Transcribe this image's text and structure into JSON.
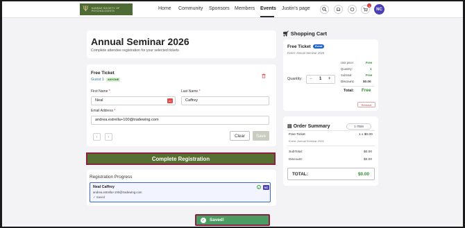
{
  "nav": {
    "logo_text": "KANSAS SOCIETY OF PSYCHOLOGISTS",
    "links": [
      "Home",
      "Community",
      "Sponsors",
      "Members",
      "Events",
      "Justin's page"
    ],
    "active": "Events",
    "cart_badge": "1",
    "avatar_initials": "NC"
  },
  "registration": {
    "title": "Annual Seminar 2026",
    "subtitle": "Complete attendee registration for your selected tickets",
    "ticket_title": "Free Ticket",
    "guest_label": "Guest 1",
    "guest_badge": "ANYONE",
    "first_name_label": "First Name",
    "last_name_label": "Last Name",
    "email_label": "Email Address",
    "required_mark": "*",
    "first_name_value": "Neal",
    "last_name_value": "Caffrey",
    "email_value": "andrea.estrella+100@tradewing.com",
    "clear_label": "Clear",
    "save_label": "Save",
    "complete_label": "Complete Registration"
  },
  "progress": {
    "title": "Registration Progress",
    "name": "Neal Caffrey",
    "email": "andrea.estrella+100@tradewing.com",
    "status": "✓ Saved",
    "avatar": "NC"
  },
  "toast": {
    "label": "Saved!"
  },
  "cart": {
    "title": "Shopping Cart",
    "ticket_name": "Free Ticket",
    "ticket_badge": "Event",
    "event_line": "Event: Annual Seminar 2026",
    "unit_price_label": "Unit price:",
    "unit_price_value": "Free",
    "quantity_label": "Quantity:",
    "quantity_value": "1",
    "subtotal_label": "Subtotal:",
    "subtotal_value": "Free",
    "discount_label": "Discount:",
    "discount_value": "$0.00",
    "qty_field_label": "Quantity:",
    "qty_minus": "−",
    "qty_plus": "+",
    "qty_current": "1",
    "total_label": "Total:",
    "total_value": "Free",
    "remove_label": "Remove"
  },
  "order": {
    "title": "Order Summary",
    "items_badge": "1 ITEM",
    "item_name": "Free Ticket",
    "item_qty_price": "1 x $0.00",
    "item_event": "Event: Annual Seminar 2026",
    "subtotal_label": "SubTotal:",
    "subtotal_value": "$0.00",
    "discount_label": "Discount:",
    "discount_value": "$0.00",
    "total_label": "TOTAL:",
    "total_value": "$0.00"
  },
  "colors": {
    "brand_green": "#557030",
    "accent_blue": "#1f62c9",
    "success_green": "#4a9c62",
    "avatar_purple": "#4a3fb8"
  }
}
